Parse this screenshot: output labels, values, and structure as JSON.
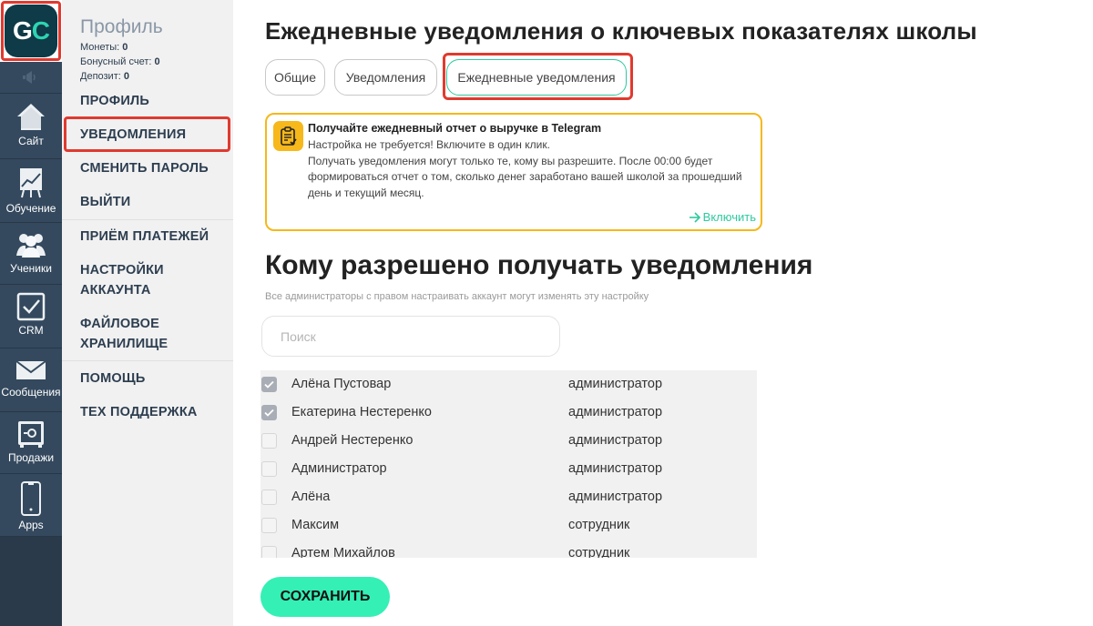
{
  "logo": {
    "letters_1": "G",
    "letters_2": "C"
  },
  "rail": {
    "items": [
      {
        "label": "Сайт",
        "icon": "house-icon"
      },
      {
        "label": "Обучение",
        "icon": "chart-board-icon"
      },
      {
        "label": "Ученики",
        "icon": "users-icon"
      },
      {
        "label": "CRM",
        "icon": "checkbox-icon"
      },
      {
        "label": "Сообщения",
        "icon": "envelope-icon"
      },
      {
        "label": "Продажи",
        "icon": "safe-icon"
      },
      {
        "label": "Apps",
        "icon": "phone-icon"
      }
    ]
  },
  "sidebar": {
    "title": "Профиль",
    "stats": [
      {
        "label": "Монеты: ",
        "value": "0"
      },
      {
        "label": "Бонусный счет: ",
        "value": "0"
      },
      {
        "label": "Депозит: ",
        "value": "0"
      }
    ],
    "items": [
      {
        "label": "ПРОФИЛЬ"
      },
      {
        "label": "УВЕДОМЛЕНИЯ",
        "active": true
      },
      {
        "label": "СМЕНИТЬ ПАРОЛЬ"
      },
      {
        "label": "ВЫЙТИ"
      },
      {
        "label": "ПРИЁМ ПЛАТЕЖЕЙ"
      },
      {
        "label": "НАСТРОЙКИ",
        "label2": "АККАУНТА"
      },
      {
        "label": "ФАЙЛОВОЕ",
        "label2": "ХРАНИЛИЩЕ"
      },
      {
        "label": "ПОМОЩЬ"
      },
      {
        "label": "ТЕХ ПОДДЕРЖКА"
      }
    ]
  },
  "main": {
    "title": "Ежедневные уведомления о ключевых показателях школы",
    "tabs": [
      {
        "label": "Общие"
      },
      {
        "label": "Уведомления"
      },
      {
        "label": "Ежедневные уведомления",
        "active": true
      }
    ],
    "promo": {
      "title": "Получайте ежедневный отчет о выручке в Telegram",
      "line1": "Настройка не требуется! Включите в один клик.",
      "line2": "Получать уведомления могут только те, кому вы разрешите. После 00:00 будет формироваться отчет о том, сколько денег заработано вашей школой за прошедший день и текущий месяц.",
      "link": "Включить"
    },
    "section_title": "Кому разрешено получать уведомления",
    "section_subtitle": "Все администраторы с правом настраивать аккаунт могут изменять эту настройку",
    "search": {
      "placeholder": "Поиск",
      "value": ""
    },
    "users": [
      {
        "name": "Алёна Пустовар",
        "role": "администратор",
        "checked": true
      },
      {
        "name": "Екатерина Нестеренко",
        "role": "администратор",
        "checked": true
      },
      {
        "name": "Андрей Нестеренко",
        "role": "администратор",
        "checked": false
      },
      {
        "name": "Администратор",
        "role": "администратор",
        "checked": false
      },
      {
        "name": "Алёна",
        "role": "администратор",
        "checked": false
      },
      {
        "name": "Максим",
        "role": "сотрудник",
        "checked": false
      },
      {
        "name": "Артем Михайлов",
        "role": "сотрудник",
        "checked": false
      }
    ],
    "save_label": "СОХРАНИТЬ"
  },
  "colors": {
    "rail_bg": "#34495e",
    "accent_green": "#34f0b5",
    "promo_border": "#f6b81a",
    "highlight_red": "#e03a2f"
  }
}
